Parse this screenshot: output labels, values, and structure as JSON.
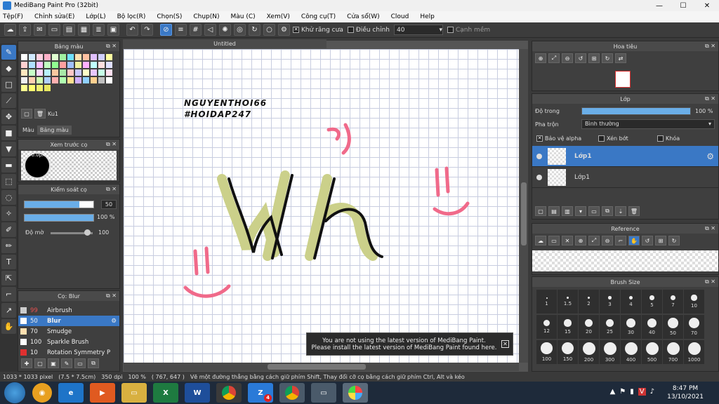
{
  "window": {
    "title": "MediBang Paint Pro (32bit)",
    "min": "—",
    "max": "☐",
    "close": "✕"
  },
  "menu": [
    "Tệp(F)",
    "Chỉnh sửa(E)",
    "Lớp(L)",
    "Bộ lọc(R)",
    "Chọn(S)",
    "Chụp(N)",
    "Màu (C)",
    "Xem(V)",
    "Công cụ(T)",
    "Cửa sổ(W)",
    "Cloud",
    "Help"
  ],
  "toolbar": {
    "antialias_label": "Khử răng cưa",
    "adjust_label": "Điều chỉnh",
    "adjust_value": "40",
    "smooth_label": "Cạnh mềm"
  },
  "color_panel": {
    "title": "Bảng màu",
    "palette_name": "Ku1",
    "tab1": "Màu",
    "tab2": "Bảng màu"
  },
  "brush_preview": {
    "title": "Xem trước cọ",
    "size": "50.0px"
  },
  "brush_control": {
    "title": "Kiểm soát cọ",
    "size_value": "50",
    "opacity_value": "100 %",
    "blur_label": "Độ mờ",
    "blur_value": "100",
    "size_level": 0.8,
    "opacity_level": 1.0,
    "blur_level": 0.8
  },
  "brush_list": {
    "title": "Cọ: Blur",
    "items": [
      {
        "num": "99",
        "name": "Airbrush",
        "color": "#cccccc"
      },
      {
        "num": "50",
        "name": "Blur",
        "color": "#ffffff"
      },
      {
        "num": "70",
        "name": "Smudge",
        "color": "#ffe0b0"
      },
      {
        "num": "100",
        "name": "Sparkle Brush",
        "color": "#ffffff"
      },
      {
        "num": "10",
        "name": "Rotation Symmetry P",
        "color": "#e03030"
      }
    ]
  },
  "document": {
    "tab_title": "Untitled"
  },
  "canvas": {
    "text_line1": "NGUYENTHOI66",
    "text_line2": "#HOIDAP247"
  },
  "notice": {
    "line1": "You are not using the latest version of MediBang Paint.",
    "line2": "Please install the latest version of MediBang Paint found here."
  },
  "navigator": {
    "title": "Hoa tiêu"
  },
  "layers": {
    "title": "Lớp",
    "opacity_label": "Độ trong",
    "opacity_value": "100 %",
    "opacity_level": 1.0,
    "blend_label": "Pha trộn",
    "blend_value": "Bình thường",
    "protect_alpha": "Bảo vệ alpha",
    "clipping": "Xén bớt",
    "lock": "Khóa",
    "items": [
      {
        "name": "Lớp1"
      },
      {
        "name": "Lớp1"
      }
    ]
  },
  "reference": {
    "title": "Reference"
  },
  "brush_size": {
    "title": "Brush Size",
    "sizes": [
      "1",
      "1.5",
      "2",
      "3",
      "4",
      "5",
      "7",
      "10",
      "12",
      "15",
      "20",
      "25",
      "30",
      "40",
      "50",
      "70",
      "100",
      "150",
      "200",
      "300",
      "400",
      "500",
      "700",
      "1000"
    ]
  },
  "status": {
    "pixels": "1033 * 1033 pixel",
    "cm": "(7.5 * 7.5cm)",
    "dpi": "350 dpi",
    "zoom": "100 %",
    "coords": "( 767, 647 )",
    "hint": "Vẽ một đường thẳng bằng cách giữ phím Shift, Thay đổi cỡ cọ bằng cách giữ phím Ctrl, Alt và kéo"
  },
  "taskbar": {
    "time": "8:47 PM",
    "date": "13/10/2021",
    "zalo_badge": "4"
  },
  "colors": {
    "accent": "#3a78c5",
    "pink": "#f06a8a",
    "olive": "#cbd08a",
    "ink": "#111111"
  }
}
